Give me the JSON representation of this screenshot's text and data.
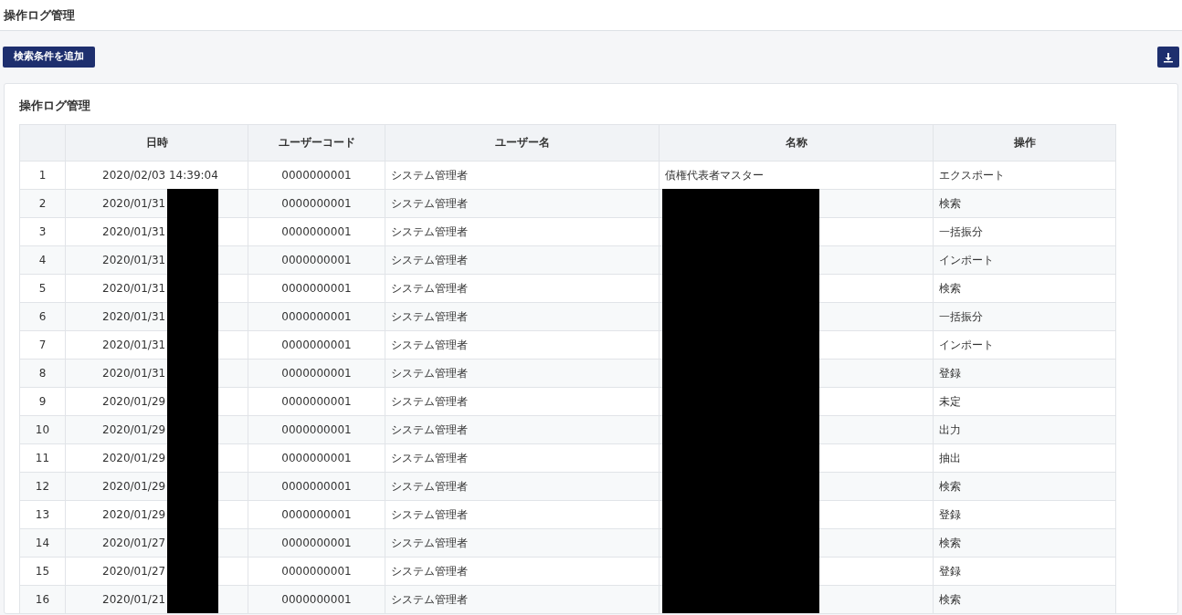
{
  "page_title": "操作ログ管理",
  "toolbar": {
    "add_condition_button": "検索条件を追加"
  },
  "card": {
    "title": "操作ログ管理"
  },
  "table": {
    "columns": [
      "日時",
      "ユーザーコード",
      "ユーザー名",
      "名称",
      "操作"
    ],
    "rows": [
      {
        "no": "1",
        "datetime": "2020/02/03 14:39:04",
        "user_code": "0000000001",
        "user_name": "システム管理者",
        "name": "債権代表者マスター",
        "operation": "エクスポート",
        "redacted": false
      },
      {
        "no": "2",
        "datetime": "2020/01/31",
        "user_code": "0000000001",
        "user_name": "システム管理者",
        "operation": "検索",
        "redacted": true
      },
      {
        "no": "3",
        "datetime": "2020/01/31",
        "user_code": "0000000001",
        "user_name": "システム管理者",
        "operation": "一括振分",
        "redacted": true
      },
      {
        "no": "4",
        "datetime": "2020/01/31",
        "user_code": "0000000001",
        "user_name": "システム管理者",
        "operation": "インポート",
        "redacted": true
      },
      {
        "no": "5",
        "datetime": "2020/01/31",
        "user_code": "0000000001",
        "user_name": "システム管理者",
        "operation": "検索",
        "redacted": true
      },
      {
        "no": "6",
        "datetime": "2020/01/31",
        "user_code": "0000000001",
        "user_name": "システム管理者",
        "operation": "一括振分",
        "redacted": true
      },
      {
        "no": "7",
        "datetime": "2020/01/31",
        "user_code": "0000000001",
        "user_name": "システム管理者",
        "operation": "インポート",
        "redacted": true
      },
      {
        "no": "8",
        "datetime": "2020/01/31",
        "user_code": "0000000001",
        "user_name": "システム管理者",
        "operation": "登録",
        "redacted": true
      },
      {
        "no": "9",
        "datetime": "2020/01/29",
        "user_code": "0000000001",
        "user_name": "システム管理者",
        "operation": "未定",
        "redacted": true
      },
      {
        "no": "10",
        "datetime": "2020/01/29",
        "user_code": "0000000001",
        "user_name": "システム管理者",
        "operation": "出力",
        "redacted": true
      },
      {
        "no": "11",
        "datetime": "2020/01/29",
        "user_code": "0000000001",
        "user_name": "システム管理者",
        "operation": "抽出",
        "redacted": true
      },
      {
        "no": "12",
        "datetime": "2020/01/29",
        "user_code": "0000000001",
        "user_name": "システム管理者",
        "operation": "検索",
        "redacted": true
      },
      {
        "no": "13",
        "datetime": "2020/01/29",
        "user_code": "0000000001",
        "user_name": "システム管理者",
        "operation": "登録",
        "redacted": true
      },
      {
        "no": "14",
        "datetime": "2020/01/27",
        "user_code": "0000000001",
        "user_name": "システム管理者",
        "operation": "検索",
        "redacted": true
      },
      {
        "no": "15",
        "datetime": "2020/01/27",
        "user_code": "0000000001",
        "user_name": "システム管理者",
        "operation": "登録",
        "redacted": true
      },
      {
        "no": "16",
        "datetime": "2020/01/21",
        "user_code": "0000000001",
        "user_name": "システム管理者",
        "operation": "検索",
        "redacted": true
      }
    ]
  }
}
